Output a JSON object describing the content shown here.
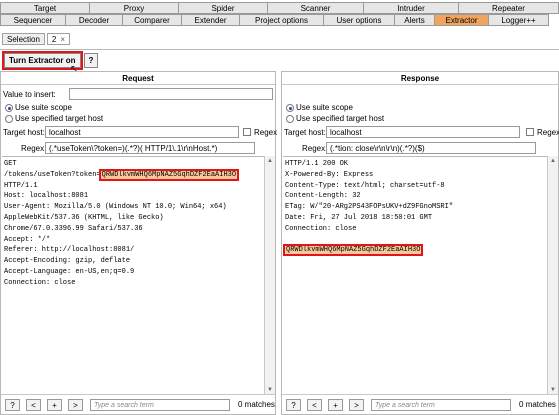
{
  "tabs_row1": [
    "Target",
    "Proxy",
    "Spider",
    "Scanner",
    "Intruder",
    "Repeater"
  ],
  "tabs_row2": [
    "Sequencer",
    "Decoder",
    "Comparer",
    "Extender",
    "Project options",
    "User options",
    "Alerts",
    "Extractor",
    "Logger++"
  ],
  "active_tab": "Extractor",
  "subtabs": {
    "selection": "Selection",
    "second": "2",
    "close": "×"
  },
  "toolbar": {
    "turn_extractor": "Turn Extractor on",
    "help": "?"
  },
  "request": {
    "title": "Request",
    "value_to_insert_label": "Value to insert:",
    "value_to_insert": "",
    "use_suite_scope": "Use suite scope",
    "use_specified_host": "Use specified target host",
    "target_host_label": "Target host:",
    "target_host": "localhost",
    "regex_label": "Regex",
    "regex_field_label": "Regex:",
    "regex_value": "(.*useToken\\?token=)(.*?)( HTTP/1\\.1\\r\\nHost.*)",
    "lines": [
      "GET",
      "/tokens/useToken?token=",
      "HTTP/1.1",
      "Host: localhost:8081",
      "User-Agent: Mozilla/5.0 (Windows NT 10.0; Win64; x64)",
      "AppleWebKit/537.36 (KHTML, like Gecko)",
      "Chrome/67.0.3396.99 Safari/537.36",
      "Accept: */*",
      "Referer: http://localhost:8081/",
      "Accept-Encoding: gzip, deflate",
      "Accept-Language: en-US,en;q=0.9",
      "Connection: close"
    ],
    "token": "QRWDlkvmWHQ6MpNAZ5GqhDZF2EaAIH3O",
    "search_placeholder": "Type a search term",
    "matches": "0 matches"
  },
  "response": {
    "title": "Response",
    "use_suite_scope": "Use suite scope",
    "use_specified_host": "Use specified target host",
    "target_host_label": "Target host:",
    "target_host": "localhost",
    "regex_label": "Regex",
    "regex_field_label": "Regex:",
    "regex_value": "(.*tion: close\\r\\n\\r\\n)(.*?)($)",
    "lines": [
      "HTTP/1.1 200 OK",
      "X-Powered-By: Express",
      "Content-Type: text/html; charset=utf-8",
      "Content-Length: 32",
      "ETag: W/\"20-ARg2PS43FOPsUKV+dZ9FGnoMSRI\"",
      "Date: Fri, 27 Jul 2018 18:50:01 GMT",
      "Connection: close",
      ""
    ],
    "token": "QRWDlkvmWHQ6MpNAZ5GqhDZF2EaAIH3O",
    "search_placeholder": "Type a search term",
    "matches": "0 matches"
  },
  "nav_buttons": {
    "help": "?",
    "prev": "<",
    "add": "+",
    "next": ">"
  },
  "colors": {
    "active_tab": "#f1a45d",
    "highlight": "#f9c89a",
    "annotation": "#e0161b"
  }
}
